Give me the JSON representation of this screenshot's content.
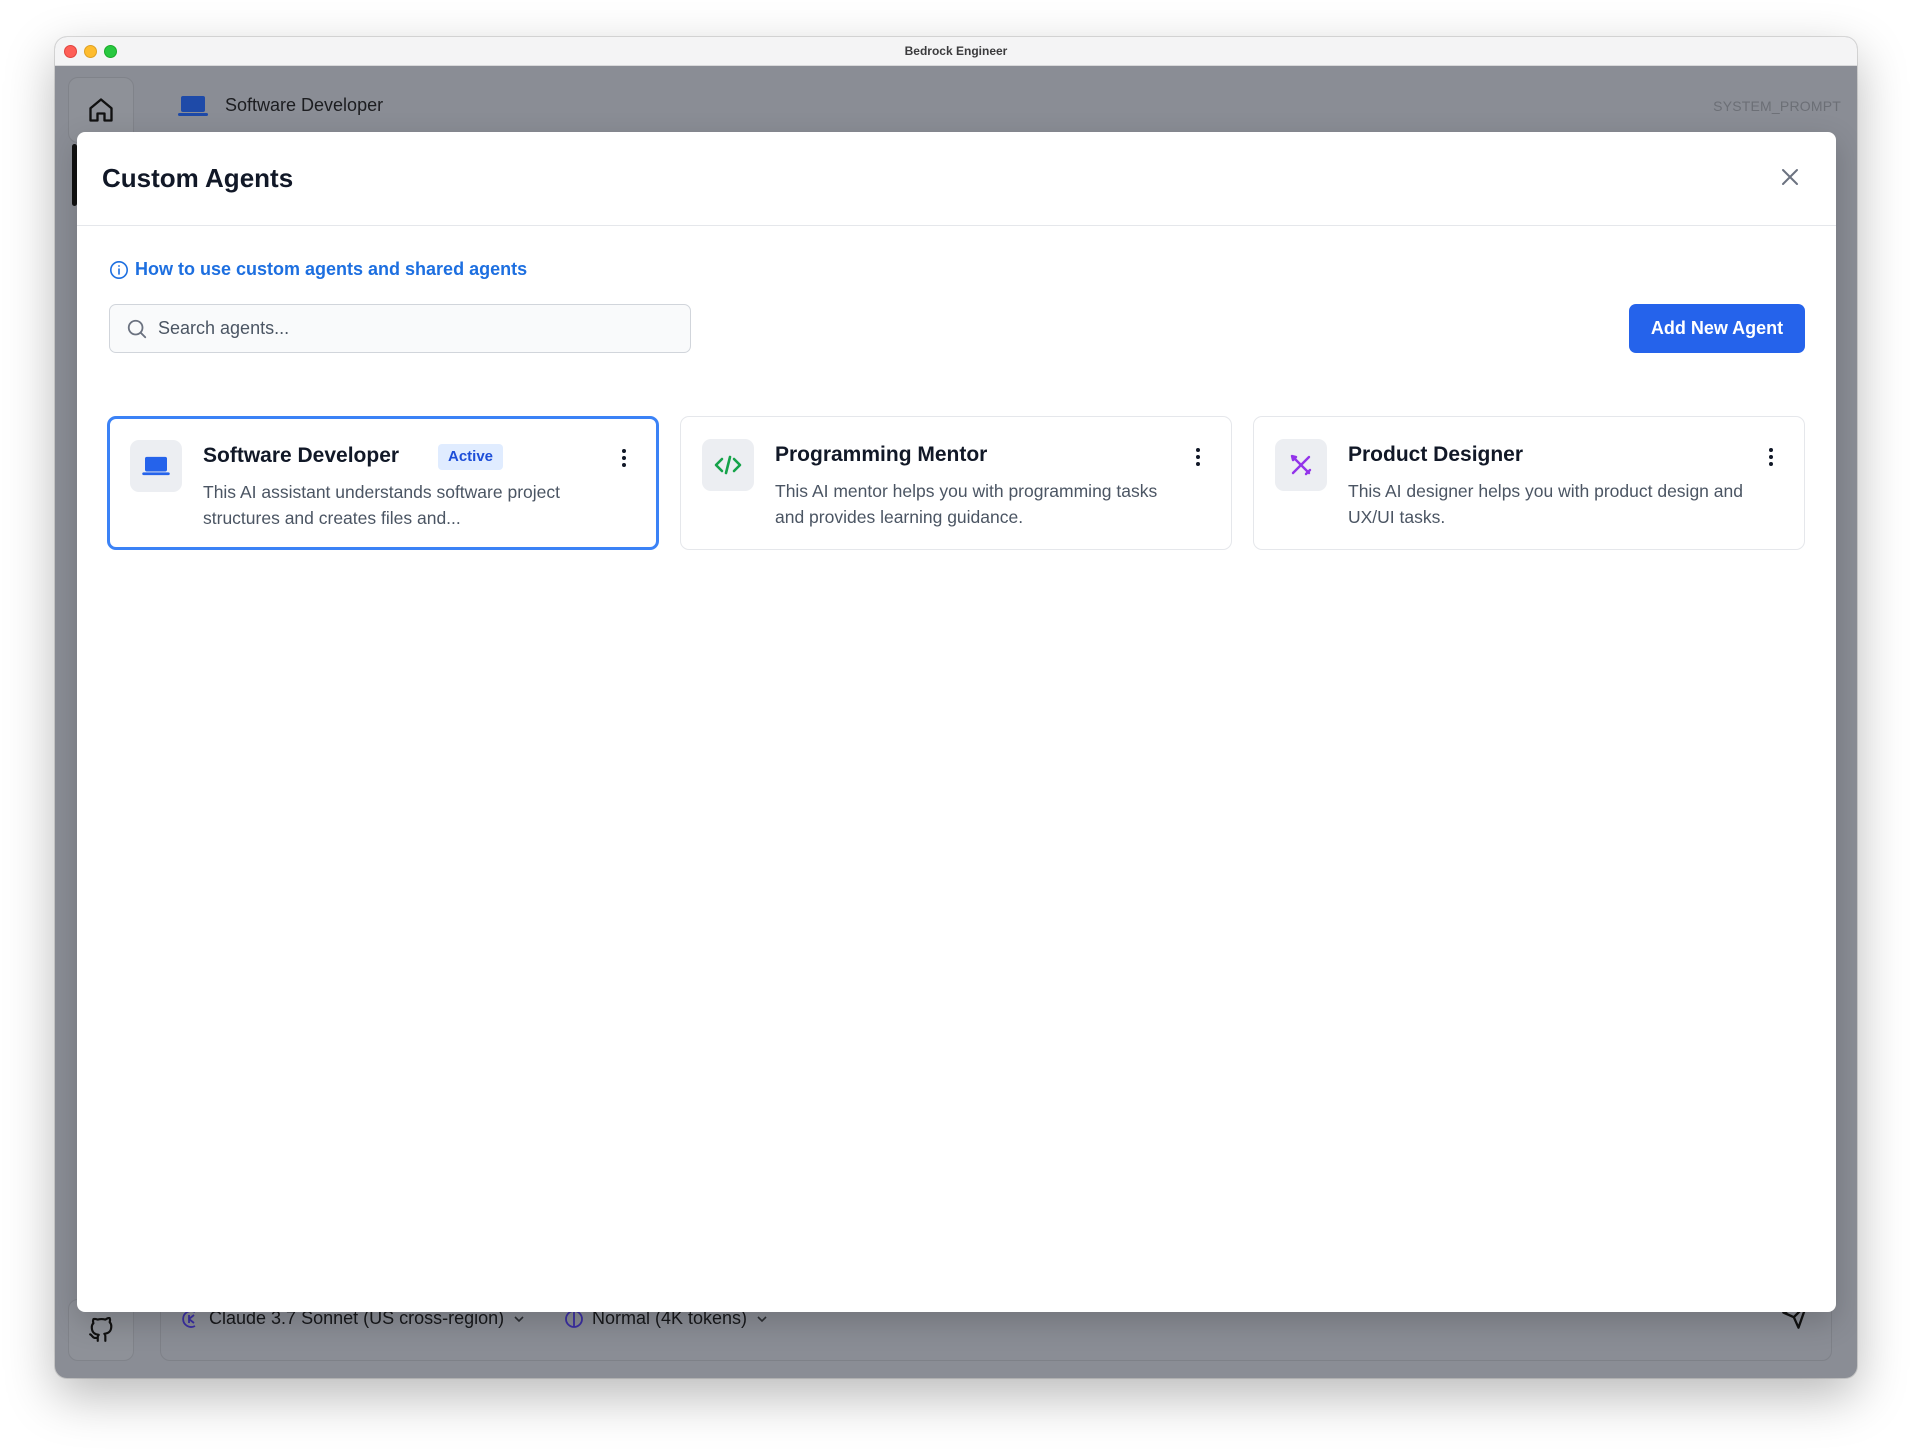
{
  "window": {
    "title": "Bedrock Engineer"
  },
  "background_app": {
    "current_agent": "Software Developer",
    "system_prompt_label": "SYSTEM_PROMPT",
    "model_selector": "Claude 3.7 Sonnet (US cross-region)",
    "thinking_mode": "Normal (4K tokens)"
  },
  "modal": {
    "title": "Custom Agents",
    "help_link": "How to use custom agents and shared agents",
    "search_placeholder": "Search agents...",
    "add_button": "Add New Agent",
    "agents": [
      {
        "name": "Software Developer",
        "badge": "Active",
        "description": "This AI assistant understands software project structures and creates files and...",
        "icon": "laptop-icon",
        "icon_color": "#2563eb",
        "active": true
      },
      {
        "name": "Programming Mentor",
        "description": "This AI mentor helps you with programming tasks and provides learning guidance.",
        "icon": "code-icon",
        "icon_color": "#16a34a",
        "active": false
      },
      {
        "name": "Product Designer",
        "description": "This AI designer helps you with product design and UX/UI tasks.",
        "icon": "design-tools-icon",
        "icon_color": "#9333ea",
        "active": false
      }
    ]
  },
  "colors": {
    "accent": "#2563eb",
    "active_border": "#3b82f6",
    "link": "#1d6fe0"
  }
}
